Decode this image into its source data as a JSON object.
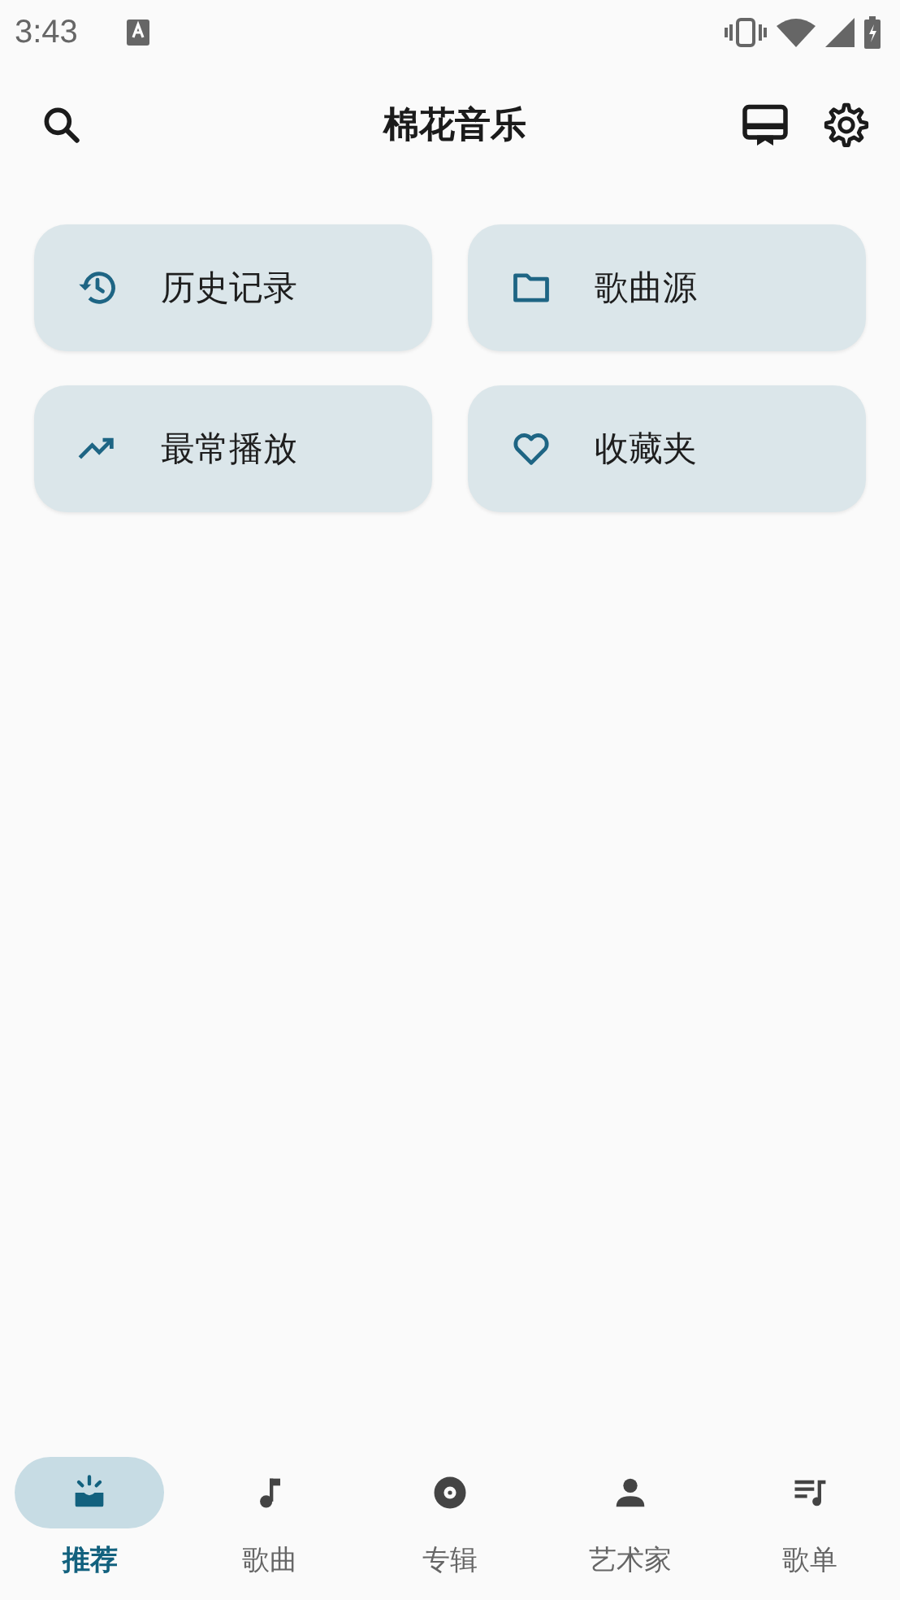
{
  "status_bar": {
    "time": "3:43"
  },
  "app_bar": {
    "title": "棉花音乐"
  },
  "shortcuts": [
    {
      "label": "历史记录"
    },
    {
      "label": "歌曲源"
    },
    {
      "label": "最常播放"
    },
    {
      "label": "收藏夹"
    }
  ],
  "bottom_nav": [
    {
      "label": "推荐",
      "selected": true
    },
    {
      "label": "歌曲",
      "selected": false
    },
    {
      "label": "专辑",
      "selected": false
    },
    {
      "label": "艺术家",
      "selected": false
    },
    {
      "label": "歌单",
      "selected": false
    }
  ]
}
